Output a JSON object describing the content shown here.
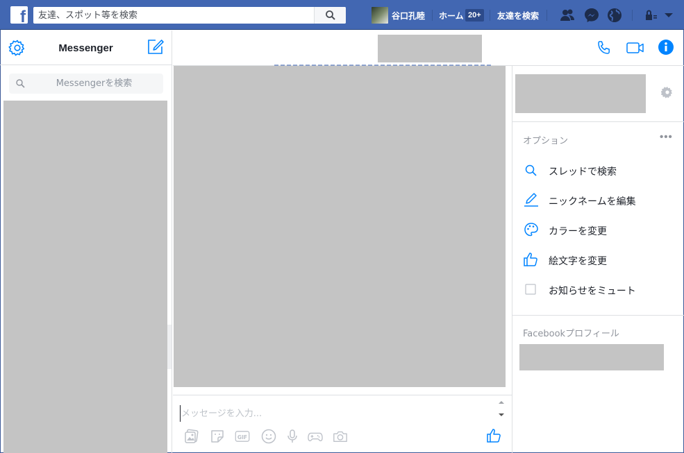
{
  "topbar": {
    "logo": "f",
    "search_placeholder": "友達、スポット等を検索",
    "user_name": "谷口孔睦",
    "home_label": "ホーム",
    "home_badge": "20+",
    "find_friends_label": "友達を検索",
    "icons": [
      "friend-requests-icon",
      "messenger-icon",
      "notifications-globe-icon",
      "privacy-lock-icon",
      "dropdown-arrow-icon"
    ]
  },
  "left": {
    "title": "Messenger",
    "search_placeholder": "Messengerを検索"
  },
  "compose": {
    "placeholder": "メッセージを入力...",
    "tools": [
      "photo-icon",
      "sticker-icon",
      "gif-icon",
      "emoji-icon",
      "microphone-icon",
      "game-icon",
      "camera-icon",
      "like-icon"
    ]
  },
  "right": {
    "options_title": "オプション",
    "options": [
      {
        "label": "スレッドで検索",
        "icon": "search-icon"
      },
      {
        "label": "ニックネームを編集",
        "icon": "pencil-icon"
      },
      {
        "label": "カラーを変更",
        "icon": "palette-icon"
      },
      {
        "label": "絵文字を変更",
        "icon": "thumbs-up-icon"
      },
      {
        "label": "お知らせをミュート",
        "icon": "checkbox-icon"
      }
    ],
    "profile_title": "Facebookプロフィール"
  },
  "colors": {
    "brand": "#4267b2",
    "accent": "#0084ff",
    "placeholder_block": "#c4c4c4"
  }
}
